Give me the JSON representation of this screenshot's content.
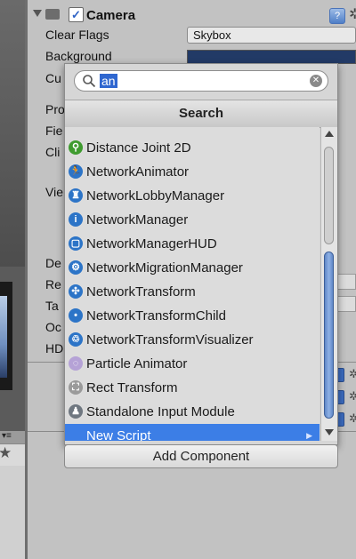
{
  "camera": {
    "title": "Camera",
    "checked": "✓",
    "help": "?",
    "cog": "✲"
  },
  "props": [
    {
      "label": "Clear Flags"
    },
    {
      "label": "Background"
    },
    {
      "label": "Cu"
    },
    {
      "label": "Pro"
    },
    {
      "label": "Fie"
    },
    {
      "label": "Cli"
    },
    {
      "label": "Vie"
    },
    {
      "label": "De"
    },
    {
      "label": "Re"
    },
    {
      "label": "Ta"
    },
    {
      "label": "Oc"
    },
    {
      "label": "HD"
    }
  ],
  "clear_flags_value": "Skybox",
  "scene_toolbar": "▾≡",
  "scene_star": "★",
  "search": {
    "query": "an"
  },
  "popup": {
    "title": "Search",
    "items": [
      {
        "label": "Distance Joint 2D",
        "icon": "joint-icon",
        "color": "#3f9b2f",
        "glyph": "⚲"
      },
      {
        "label": "NetworkAnimator",
        "icon": "network-animator-icon",
        "color": "#2c74c7",
        "glyph": "🏃"
      },
      {
        "label": "NetworkLobbyManager",
        "icon": "lobby-icon",
        "color": "#2c74c7",
        "glyph": "♜"
      },
      {
        "label": "NetworkManager",
        "icon": "info-icon",
        "color": "#2c74c7",
        "glyph": "i"
      },
      {
        "label": "NetworkManagerHUD",
        "icon": "hud-icon",
        "color": "#2c74c7",
        "glyph": "▢"
      },
      {
        "label": "NetworkMigrationManager",
        "icon": "migration-icon",
        "color": "#2c74c7",
        "glyph": "⚙"
      },
      {
        "label": "NetworkTransform",
        "icon": "transform-icon",
        "color": "#2c74c7",
        "glyph": "✣"
      },
      {
        "label": "NetworkTransformChild",
        "icon": "transform-child-icon",
        "color": "#2c74c7",
        "glyph": "•"
      },
      {
        "label": "NetworkTransformVisualizer",
        "icon": "visualizer-icon",
        "color": "#2c74c7",
        "glyph": "♲"
      },
      {
        "label": "Particle Animator",
        "icon": "particle-icon",
        "color": "#b5a2d6",
        "glyph": "◌"
      },
      {
        "label": "Rect Transform",
        "icon": "rect-transform-icon",
        "color": "#9a9a9a",
        "glyph": "⛶"
      },
      {
        "label": "Standalone Input Module",
        "icon": "joystick-icon",
        "color": "#6f7780",
        "glyph": "♟"
      },
      {
        "label": "New Script",
        "icon": "",
        "color": "",
        "glyph": ""
      }
    ]
  },
  "add_component": "Add Component",
  "colors": {
    "selection": "#3c7ee6",
    "accent": "#2f67d0",
    "background_swatch": "#223a66"
  }
}
